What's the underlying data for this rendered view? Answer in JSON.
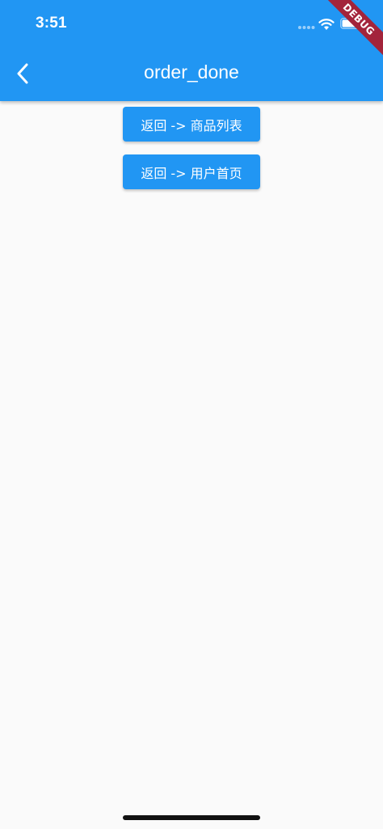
{
  "status_bar": {
    "time": "3:51"
  },
  "app_bar": {
    "title": "order_done",
    "back_icon": "chevron-left-icon",
    "background": "#2196f3"
  },
  "debug_banner": {
    "label": "DEBUG",
    "color": "#a3243b"
  },
  "buttons": [
    {
      "label": "返回 -> 商品列表"
    },
    {
      "label": "返回 -> 用户首页"
    }
  ],
  "colors": {
    "primary": "#2196f3",
    "background": "#fafafa",
    "on_primary": "#ffffff"
  }
}
